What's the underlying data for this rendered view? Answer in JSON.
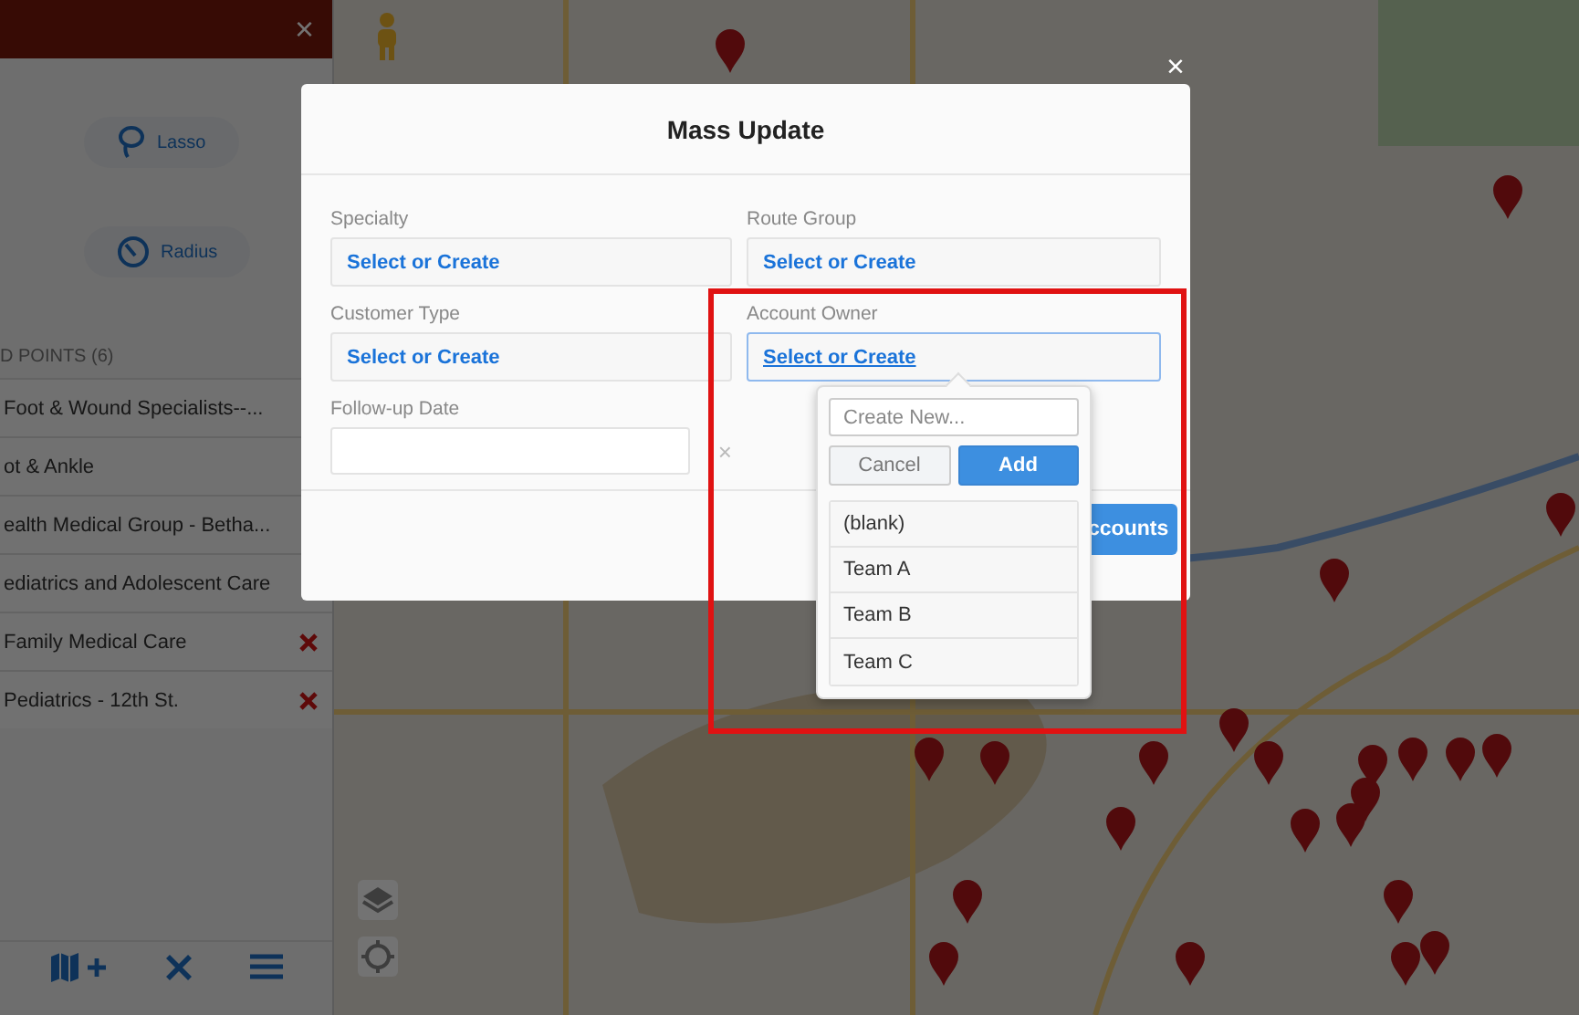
{
  "sidebar": {
    "close": "×",
    "tools": [
      {
        "label": "Lasso",
        "kind": "lasso"
      },
      {
        "label": "Radius",
        "kind": "radius"
      }
    ],
    "section_title": "D POINTS (6)",
    "points": [
      {
        "name": "Foot & Wound Specialists--...",
        "removable": false
      },
      {
        "name": "ot & Ankle",
        "removable": false
      },
      {
        "name": "ealth Medical Group - Betha...",
        "removable": false
      },
      {
        "name": "ediatrics and Adolescent Care",
        "removable": false
      },
      {
        "name": "Family Medical Care",
        "removable": true
      },
      {
        "name": "Pediatrics - 12th St.",
        "removable": true
      }
    ],
    "toolbar": [
      {
        "kind": "route"
      },
      {
        "kind": "clear"
      },
      {
        "kind": "menu"
      }
    ]
  },
  "map_controls": [
    {
      "kind": "pegman"
    },
    {
      "kind": "layers"
    },
    {
      "kind": "locate"
    }
  ],
  "modal": {
    "title": "Mass Update",
    "close": "×",
    "fields": [
      {
        "label": "Specialty",
        "value": "Select or Create",
        "focused": false
      },
      {
        "label": "Route Group",
        "value": "Select or Create",
        "focused": false
      },
      {
        "label": "Customer Type",
        "value": "Select or Create",
        "focused": false
      },
      {
        "label": "Account Owner",
        "value": "Select or Create",
        "focused": true
      }
    ],
    "date": {
      "label": "Follow-up Date",
      "clear": "×"
    },
    "submit": "ccounts"
  },
  "dropdown": {
    "placeholder": "Create New...",
    "cancel": "Cancel",
    "add": "Add",
    "options": [
      "(blank)",
      "Team A",
      "Team B",
      "Team C"
    ]
  }
}
